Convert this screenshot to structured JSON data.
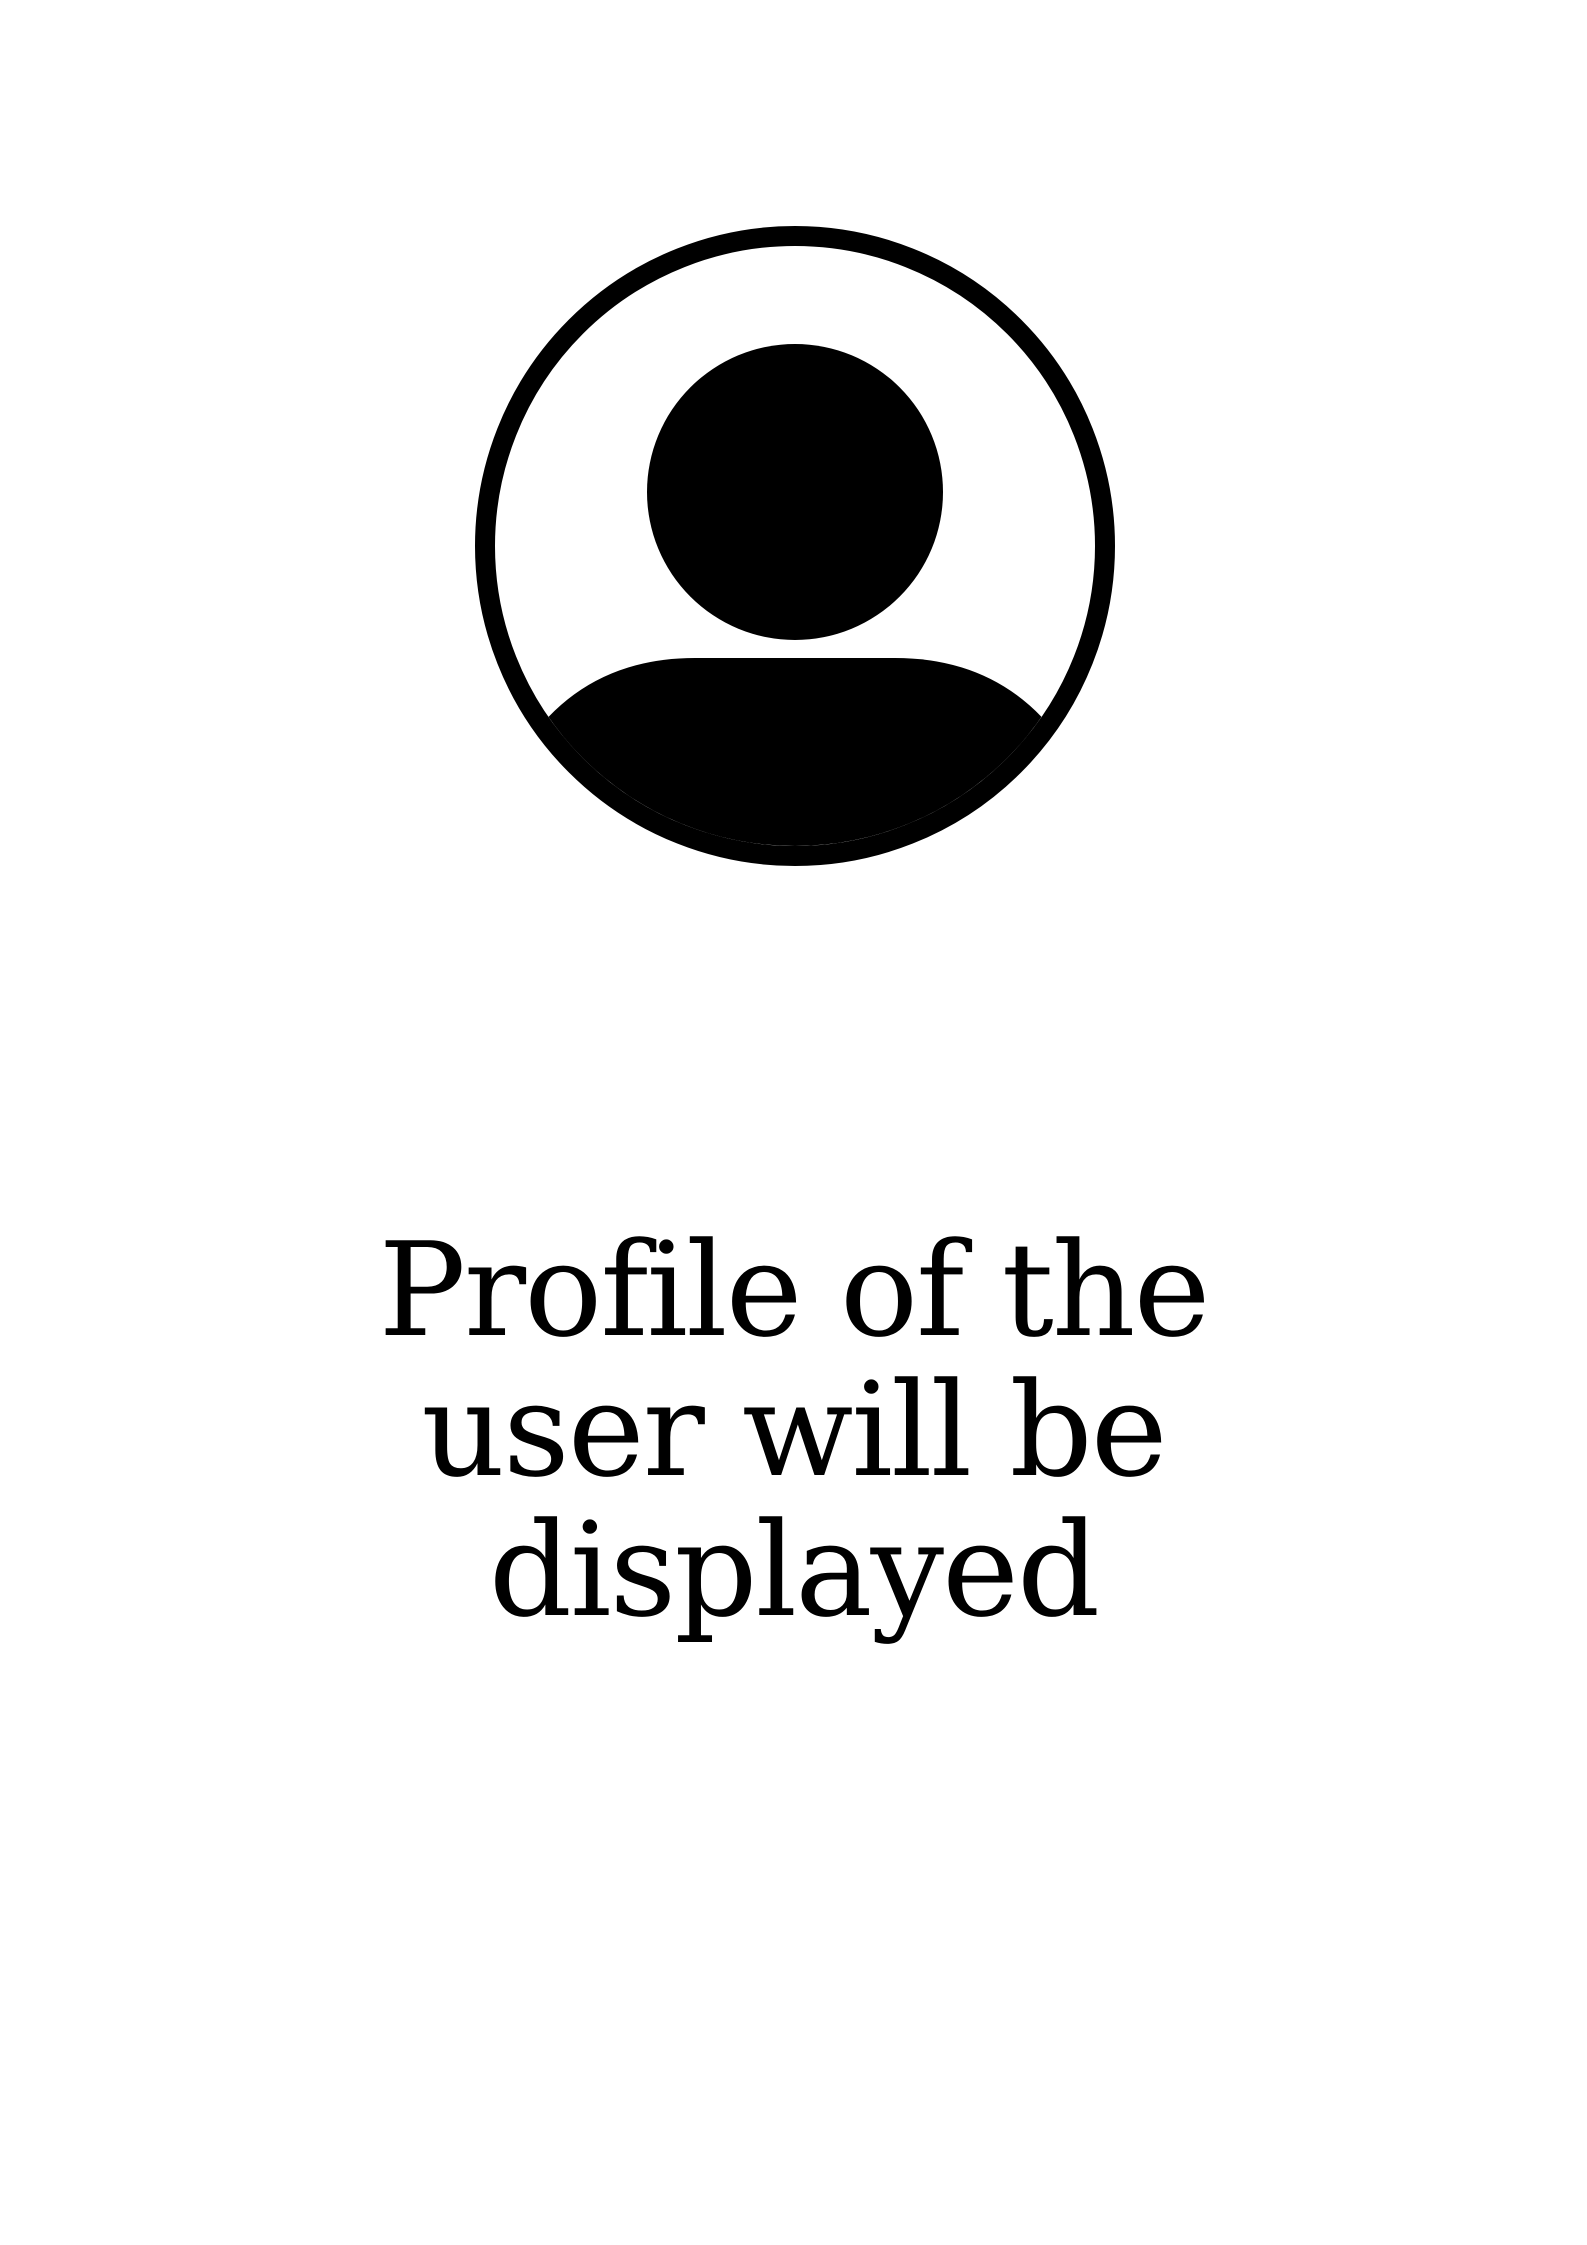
{
  "placeholder": {
    "icon": "user-avatar-icon",
    "message_lines": [
      "Profile of the",
      "user will be",
      "displayed"
    ]
  },
  "colors": {
    "background": "#ffffff",
    "foreground": "#000000"
  }
}
